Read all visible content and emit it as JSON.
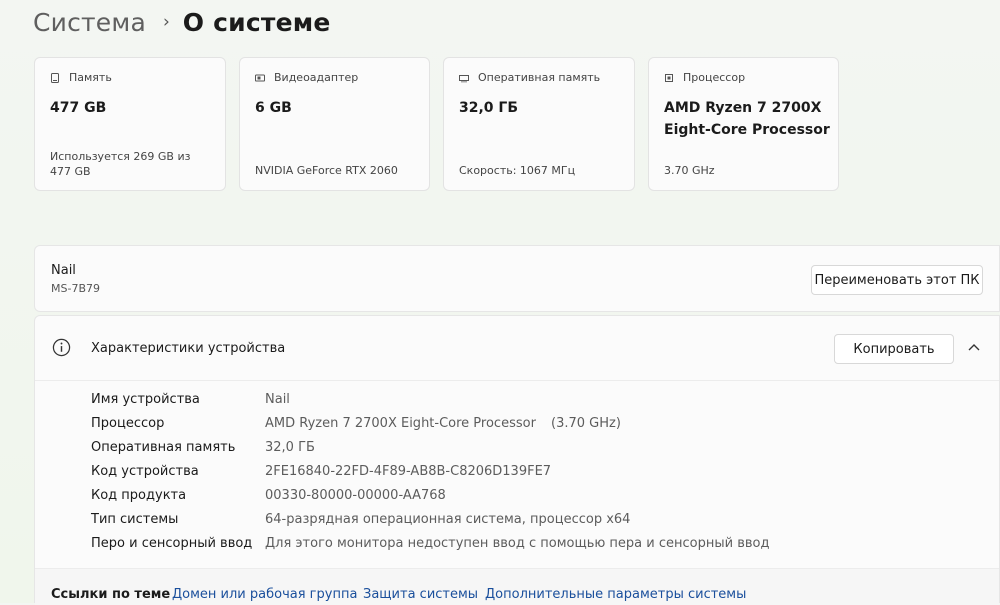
{
  "breadcrumb": {
    "parent": "Система",
    "separator": "›",
    "current": "О системе"
  },
  "cards": [
    {
      "icon": "storage-icon",
      "label": "Память",
      "value": "477 GB",
      "sub": "Используется 269 GB из 477 GB"
    },
    {
      "icon": "gpu-icon",
      "label": "Видеоадаптер",
      "value": "6 GB",
      "sub": "NVIDIA GeForce RTX 2060"
    },
    {
      "icon": "ram-icon",
      "label": "Оперативная память",
      "value": "32,0 ГБ",
      "sub": "Скорость: 1067 МГц"
    },
    {
      "icon": "cpu-icon",
      "label": "Процессор",
      "value": "AMD Ryzen 7 2700X Eight-Core Processor",
      "sub": "3.70 GHz"
    }
  ],
  "device": {
    "name": "Nail",
    "model": "MS-7B79",
    "rename_label": "Переименовать этот ПК"
  },
  "specs": {
    "title": "Характеристики устройства",
    "copy_label": "Копировать",
    "rows": [
      {
        "label": "Имя устройства",
        "value": "Nail",
        "extra": ""
      },
      {
        "label": "Процессор",
        "value": "AMD Ryzen 7 2700X Eight-Core Processor",
        "extra": "(3.70 GHz)"
      },
      {
        "label": "Оперативная память",
        "value": "32,0 ГБ",
        "extra": ""
      },
      {
        "label": "Код устройства",
        "value": "2FE16840-22FD-4F89-AB8B-C8206D139FE7",
        "extra": ""
      },
      {
        "label": "Код продукта",
        "value": "00330-80000-00000-AA768",
        "extra": ""
      },
      {
        "label": "Тип системы",
        "value": "64-разрядная операционная система, процессор x64",
        "extra": ""
      },
      {
        "label": "Перо и сенсорный ввод",
        "value": "Для этого монитора недоступен ввод с помощью пера и сенсорный ввод",
        "extra": ""
      }
    ]
  },
  "related": {
    "title": "Ссылки по теме",
    "links": [
      "Домен или рабочая группа",
      "Защита системы",
      "Дополнительные параметры системы"
    ]
  },
  "colors": {
    "link": "#1a4f9c",
    "background": "#f1f6ee",
    "card": "#fbfbfb"
  }
}
